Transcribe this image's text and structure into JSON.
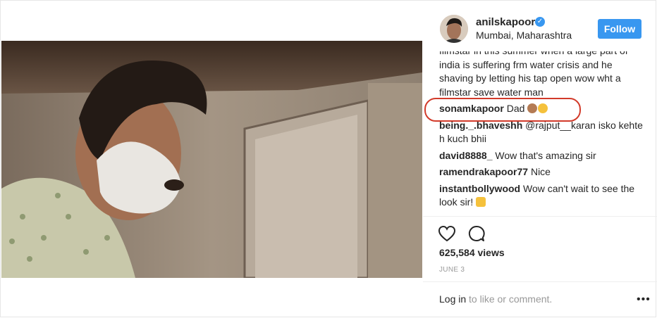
{
  "post": {
    "username": "anilskapoor",
    "location": "Mumbai, Maharashtra",
    "follow_label": "Follow",
    "views": "625,584 views",
    "date": "JUNE 3",
    "login_link": "Log in",
    "login_rest": " to like or comment."
  },
  "comments": [
    {
      "user": "",
      "text": "filmstar in this summer when a large part of india is suffering frm water crisis and he shaving by letting his tap open wow wht a filmstar save water man",
      "emoji": ""
    },
    {
      "user": "sonamkapoor",
      "text": "Dad",
      "emoji": "see-no-evil-monkey and tears-of-joy"
    },
    {
      "user": "being._.bhaveshh",
      "text": "@rajput__karan isko kehte h kuch bhii",
      "emoji": ""
    },
    {
      "user": "david8888_",
      "text": "Wow that's amazing sir",
      "emoji": ""
    },
    {
      "user": "ramendrakapoor77",
      "text": "Nice",
      "emoji": ""
    },
    {
      "user": "instantbollywood",
      "text": "Wow can't wait to see the look sir!",
      "emoji": "thumbs-up"
    }
  ],
  "icons": {
    "like": "heart-icon",
    "comment": "comment-icon",
    "more": "more-options-icon",
    "verified": "verified-badge-icon"
  },
  "colors": {
    "accent": "#3897f0",
    "highlight_oval": "#d23a2a",
    "muted_text": "#999999"
  }
}
